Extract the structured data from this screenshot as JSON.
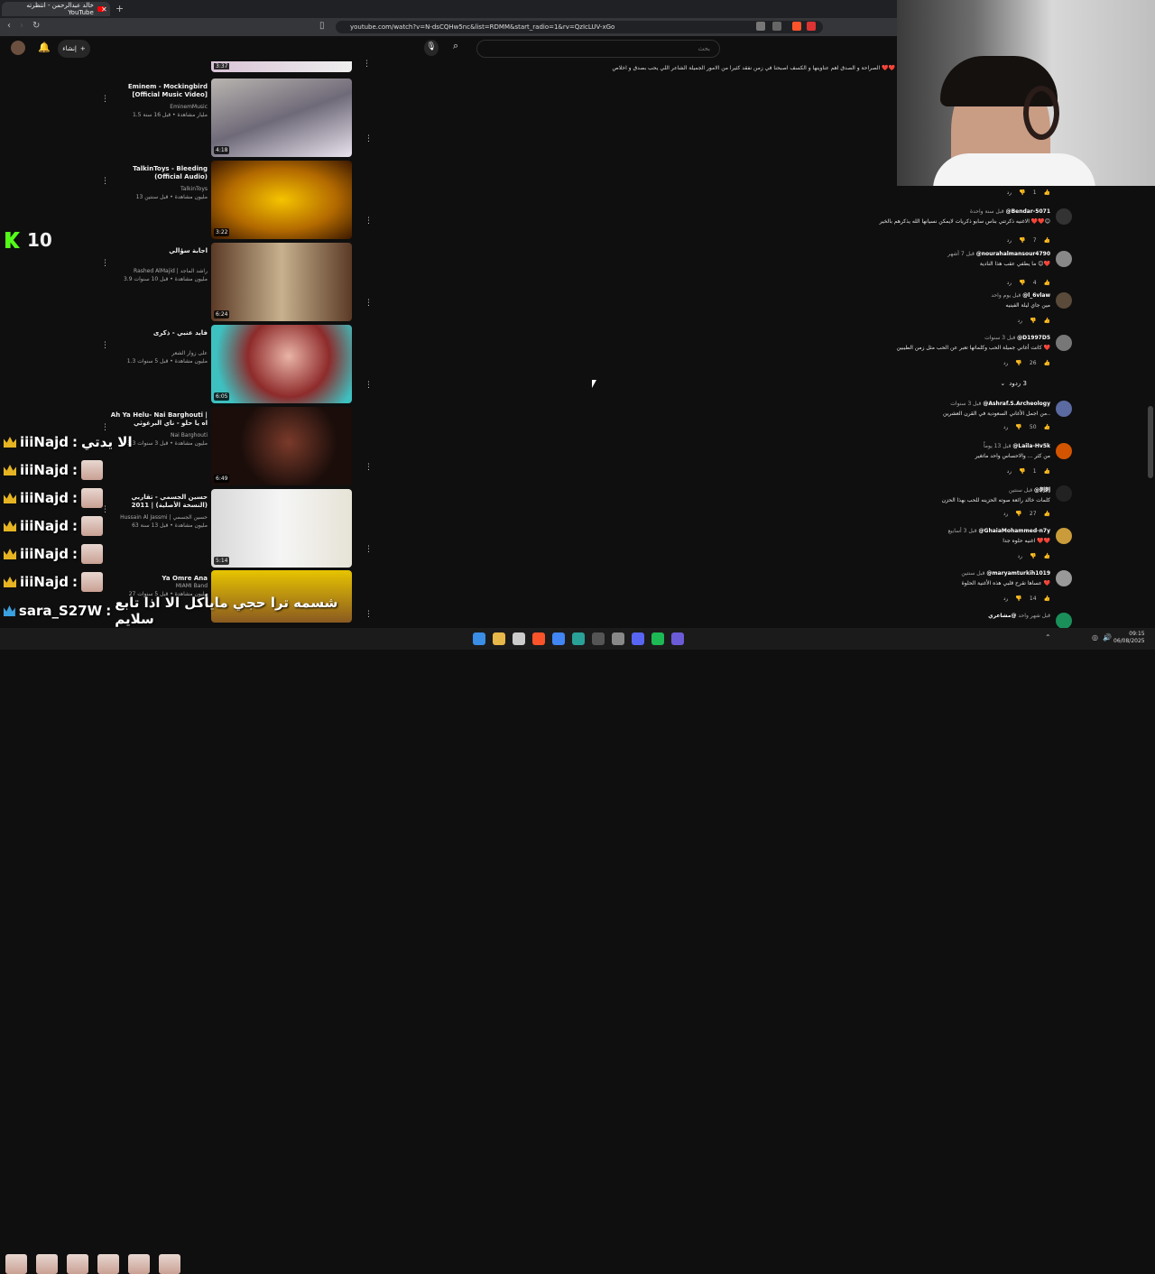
{
  "browser": {
    "tab_title": "خالد عبدالرحمن - انتظرته YouTube",
    "url": "youtube.com/watch?v=N-dsCQHw5nc&list=RDMM&start_radio=1&rv=QzIcLUV-xGo"
  },
  "header": {
    "search_placeholder": "بحث",
    "create_label": "إنشاء"
  },
  "recommendations": [
    {
      "title": "Eminem - Mockingbird [Official Music Video]",
      "channel": "EminemMusic",
      "meta": "1.5 مليار مشاهدة • قبل 16 سنة",
      "duration": "4:18"
    },
    {
      "title": "TalkinToys - Bleeding (Official Audio)",
      "channel": "TalkinToys",
      "meta": "13 مليون مشاهدة • قبل سنتين",
      "duration": "3:22"
    },
    {
      "title": "اجابة سؤالي",
      "channel": "Rashed AlMajid | راشد الماجد",
      "meta": "3.9 مليون مشاهدة • قبل 10 سنوات",
      "duration": "6:24"
    },
    {
      "title": "فايد عنبي - ذكرى",
      "channel": "على زوار الشعر",
      "meta": "1.3 مليون مشاهدة • قبل 5 سنوات",
      "duration": "6:05"
    },
    {
      "title": "Ah Ya Helu- Nai Barghouti | اه يا حلو - ناي البرغوثي",
      "channel": "Nai Barghouti",
      "meta": "3.3 مليون مشاهدة • قبل 3 سنوات",
      "duration": "6:49"
    },
    {
      "title": "حسين الجسمي - تقاربي (النسخة الأصلية) | 2011",
      "channel": "Hussain Al Jassmi | حسين الجسمي",
      "meta": "63 مليون مشاهدة • قبل 13 سنة",
      "duration": "5:14"
    },
    {
      "title": "Ya Omre Ana",
      "channel": "MIAMI Band",
      "meta": "27 مليون مشاهدة • قبل 5 سنوات",
      "duration": ""
    }
  ],
  "top_duration": "3:37",
  "top_comment": "الصراحة و الصدق اهم عناوينها و الكسف اصبحنا في زمن نفقد كثيرا من الامور الجميلة الشاعر اللي يحب بصدق و اخلاص ❤️❤️",
  "comments": [
    {
      "author": "@Bendar-5071",
      "time": "قبل سنة واحدة",
      "text": "الاغنيه ذكرتني بناس سابو ذكريات لايمكن نسيانها الله يذكرهم بالخير ❤️❤️😊",
      "likes": "7",
      "avatar_color": "#333333"
    },
    {
      "author": "@nourahalmansour4790",
      "time": "قبل 7 أشهر",
      "text": "ما يطفي عقب هذا النادية 😊❤️",
      "likes": "4",
      "avatar_color": "#888888"
    },
    {
      "author": "@l_6vlaw",
      "time": "قبل يوم واحد",
      "text": "مين جاي ليلة الفينيه",
      "likes": "",
      "avatar_color": "#5a4a3a"
    },
    {
      "author": "@D1997D5",
      "time": "قبل 3 سنوات",
      "text": "كانت أغاني جميلة الحب وكلماتها تعبر عن الحب مثل زمن الطيبين ❤️",
      "likes": "26",
      "avatar_color": "#777777"
    },
    {
      "author": "@Ashraf.S.Archeology",
      "time": "قبل 3 سنوات",
      "text": "من اجمل الأغاني السعودية في القرن العشرين.. ",
      "likes": "50",
      "avatar_color": "#5b6aa0"
    },
    {
      "author": "@Laila-Hv5k",
      "time": "قبل 13 يوماً",
      "text": "من كثر ... والاحساس واحد ماتغير",
      "likes": "1",
      "avatar_color": "#d35400"
    },
    {
      "author": "@刺刺",
      "time": "قبل سنتين",
      "text": "كلمات خالد رائعة صوته الحزينه للحب بهذا الحزن",
      "likes": "27",
      "avatar_color": "#222222"
    },
    {
      "author": "@GhaiaMohammed-n7y",
      "time": "قبل 3 أسابيع",
      "text": "اغنيه حلوه جدا ❤️❤️",
      "likes": "",
      "avatar_color": "#c99b3a"
    },
    {
      "author": "@maryamturkih1019",
      "time": "قبل سنتين",
      "text": "عساها تقرح قلبي هذه الأغنية الحلوة ❤️",
      "likes": "14",
      "avatar_color": "#999999"
    },
    {
      "author": "@مشاعري",
      "time": "قبل شهر واحد",
      "text": "",
      "likes": "",
      "avatar_color": "#1a8f5a"
    }
  ],
  "replies_label": "3 ردود",
  "first_like": "1",
  "stream": {
    "viewer_count": "10",
    "chat": [
      {
        "user": "iiiNajd",
        "message": "الا يدتي"
      },
      {
        "user": "iiiNajd",
        "message": ""
      },
      {
        "user": "iiiNajd",
        "message": ""
      },
      {
        "user": "iiiNajd",
        "message": ""
      },
      {
        "user": "iiiNajd",
        "message": ""
      },
      {
        "user": "iiiNajd",
        "message": ""
      },
      {
        "user": "sara_S27W",
        "message": "شسمه ترا حجي مايأكل الا اذا تابع سلايم"
      }
    ]
  },
  "taskbar": {
    "time": "09:15",
    "date": "06/08/2025"
  }
}
